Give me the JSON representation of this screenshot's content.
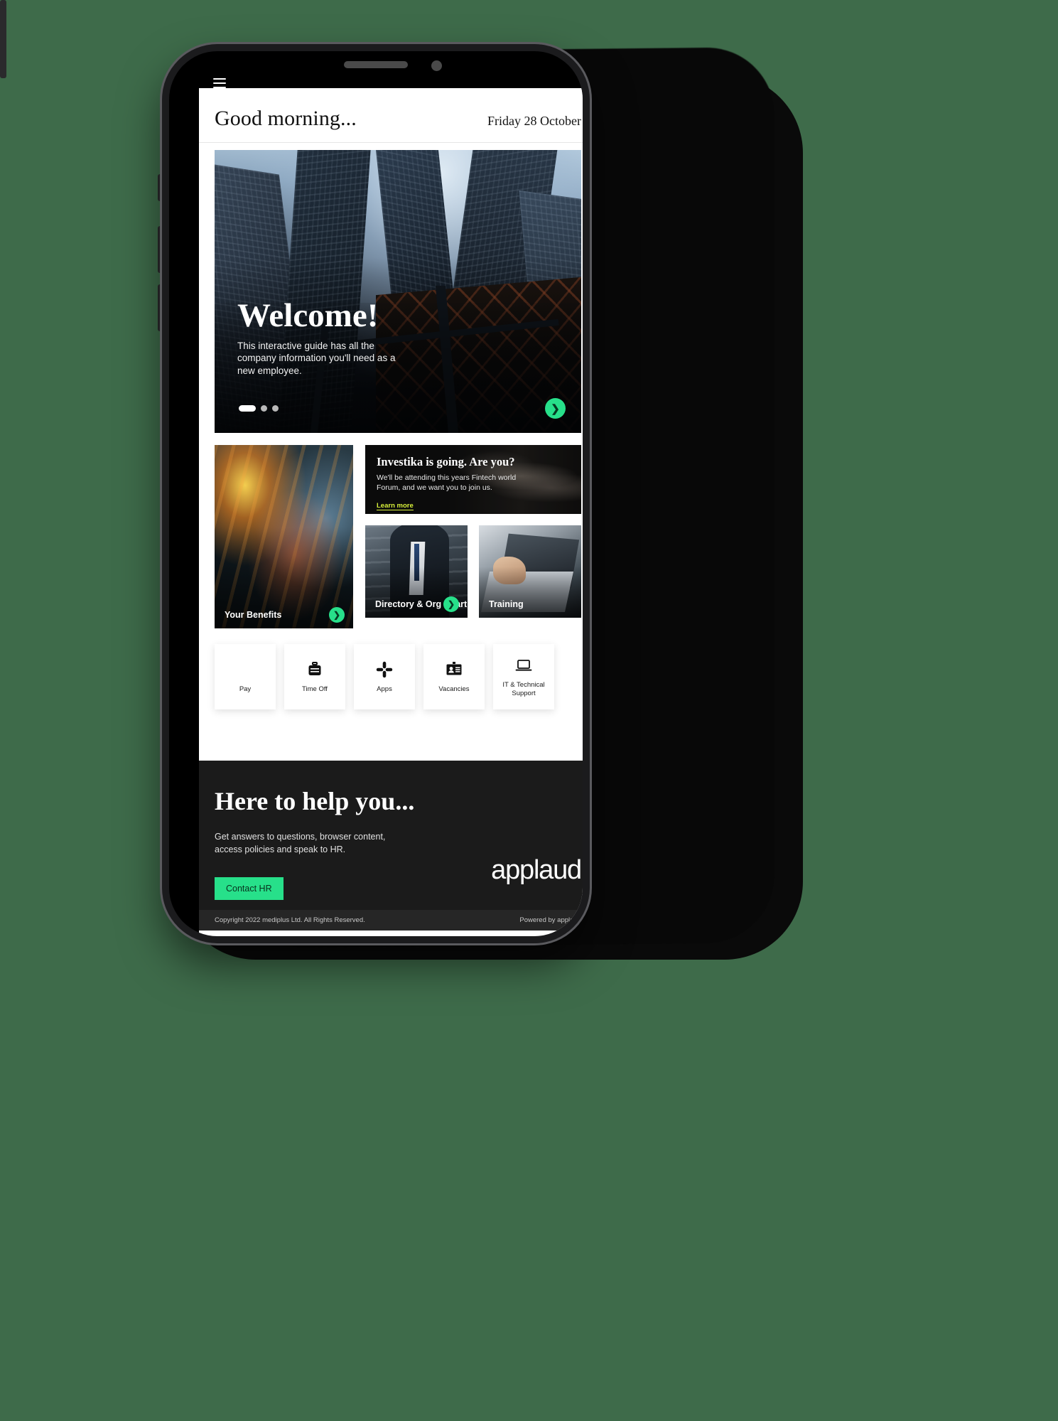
{
  "header": {
    "greeting": "Good morning...",
    "date": "Friday 28 October",
    "menu_icon": "hamburger-icon"
  },
  "hero": {
    "title": "Welcome!",
    "subtitle": "This interactive guide has all the company information you'll need as a new employee.",
    "next_icon": "❯",
    "slides": 3,
    "active_slide": 1
  },
  "cards": {
    "benefits": {
      "label": "Your Benefits",
      "arrow": "❯"
    },
    "investika": {
      "title": "Investika is going. Are you?",
      "subtitle": "We'll be attending this years Fintech world Forum, and we want you to join us.",
      "link": "Learn more"
    },
    "orgchart": {
      "label": "Directory & Org Chart",
      "arrow": "❯"
    },
    "training": {
      "label": "Training"
    }
  },
  "quicklinks": [
    {
      "label": "Pay",
      "icon": "coins-icon"
    },
    {
      "label": "Time Off",
      "icon": "suitcase-icon"
    },
    {
      "label": "Apps",
      "icon": "slack-icon"
    },
    {
      "label": "Vacancies",
      "icon": "id-badge-icon"
    },
    {
      "label": "IT & Technical Support",
      "icon": "laptop-icon"
    }
  ],
  "footer": {
    "title": "Here to help you...",
    "subtitle": "Get answers to questions, browser content, access policies and speak to HR.",
    "button": "Contact HR",
    "logo": "applaud",
    "copyright": "Copyright 2022 mediplus Ltd. All Rights Reserved.",
    "powered_by": "Powered by applaud"
  },
  "colors": {
    "accent_green": "#27e08a",
    "link_yellow": "#d9f23a",
    "footer_bg": "#1b1b1b",
    "page_bg": "#3e6b4a"
  }
}
